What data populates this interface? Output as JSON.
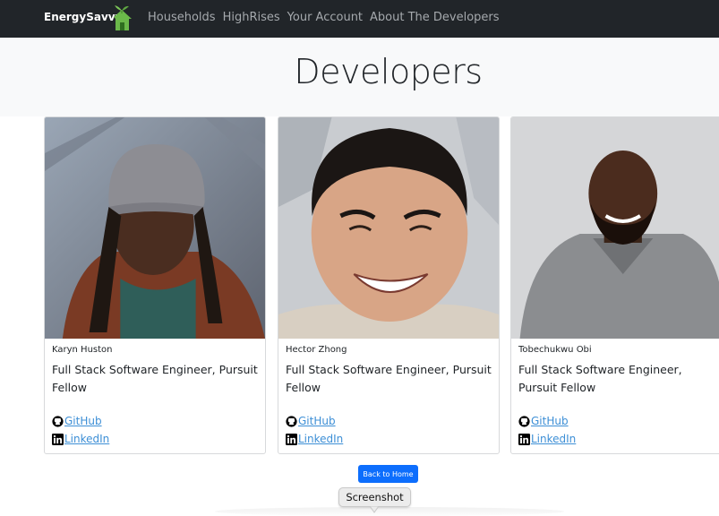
{
  "navbar": {
    "brand": "EnergySavvy",
    "logo": "house-sprout-icon",
    "links": [
      "Households",
      "HighRises",
      "Your Account",
      "About The Developers"
    ],
    "link_color": "#a5a9ad",
    "background": "#212529"
  },
  "page": {
    "title": "Developers"
  },
  "developers": [
    {
      "name": "Karyn Huston",
      "role": "Full Stack Software Engineer, Pursuit Fellow",
      "github": "GitHub",
      "linkedin": "LinkedIn",
      "photo": "portrait-karyn"
    },
    {
      "name": "Hector Zhong",
      "role": "Full Stack Software Engineer, Pursuit Fellow",
      "github": "GitHub",
      "linkedin": "LinkedIn",
      "photo": "portrait-hector"
    },
    {
      "name": "Tobechukwu Obi",
      "role": "Full Stack Software Engineer, Pursuit Fellow",
      "github": "GitHub",
      "linkedin": "LinkedIn",
      "photo": "portrait-tobechukwu"
    }
  ],
  "actions": {
    "back_home": "Back to Home",
    "button_color": "#0d6efd"
  },
  "tooltip": {
    "label": "Screenshot"
  }
}
